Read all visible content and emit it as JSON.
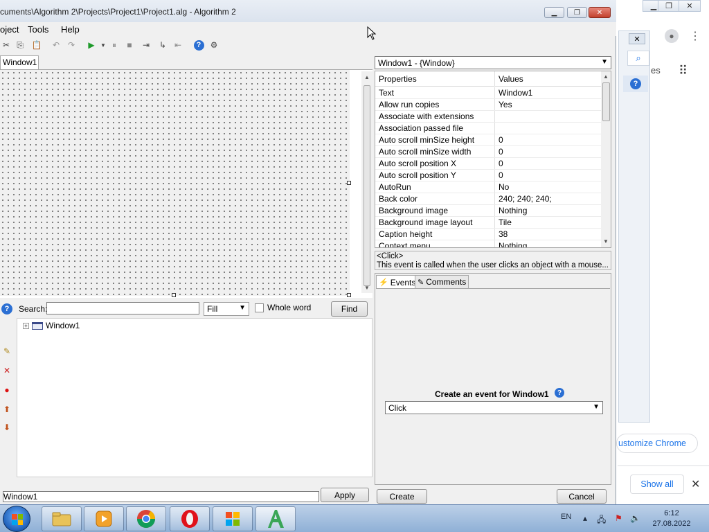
{
  "window": {
    "title": "cuments\\Algorithm 2\\Projects\\Project1\\Project1.alg - Algorithm 2",
    "minimize_glyph": "▁",
    "maximize_glyph": "❐",
    "close_glyph": "✕"
  },
  "menu": [
    "oject",
    "Tools",
    "Help"
  ],
  "toolbar_icons": [
    "cut-icon",
    "copy-icon",
    "paste-icon",
    "undo-icon",
    "redo-icon",
    "run-icon",
    "run-dropdown-icon",
    "pause-icon",
    "stop-icon",
    "step-into-icon",
    "step-over-icon",
    "step-out-icon",
    "help-icon",
    "settings-icon"
  ],
  "designer": {
    "tab_label": "Window1"
  },
  "search": {
    "label": "Search:",
    "value": "",
    "mode": "Fill",
    "whole_word_label": "Whole word",
    "whole_word_checked": false,
    "find_label": "Find"
  },
  "tree": {
    "nodes": [
      "Window1"
    ]
  },
  "name_editor": {
    "value": "Window1",
    "apply_label": "Apply"
  },
  "properties": {
    "object": "Window1 - {Window}",
    "col_properties": "Properties",
    "col_values": "Values",
    "rows": [
      {
        "name": "Text",
        "value": "Window1"
      },
      {
        "name": "Allow run copies",
        "value": "Yes"
      },
      {
        "name": "Associate with extensions",
        "value": ""
      },
      {
        "name": "Association passed file",
        "value": ""
      },
      {
        "name": "Auto scroll minSize height",
        "value": "0"
      },
      {
        "name": "Auto scroll minSize width",
        "value": "0"
      },
      {
        "name": "Auto scroll position X",
        "value": "0"
      },
      {
        "name": "Auto scroll position Y",
        "value": "0"
      },
      {
        "name": "AutoRun",
        "value": "No"
      },
      {
        "name": "Back color",
        "value": "240; 240; 240;"
      },
      {
        "name": "Background image",
        "value": "Nothing"
      },
      {
        "name": "Background image layout",
        "value": "Tile"
      },
      {
        "name": "Caption height",
        "value": "38"
      },
      {
        "name": "Context menu",
        "value": "Nothing"
      }
    ]
  },
  "description": {
    "line1": "<Click>",
    "line2": "This event is called when the user clicks an object with a mouse..."
  },
  "events": {
    "tab_events": "Events",
    "tab_comments": "Comments",
    "create_label": "Create an event for Window1",
    "selected_event": "Click",
    "create_button": "Create",
    "cancel_button": "Cancel"
  },
  "chrome": {
    "customize_label": "ustomize Chrome",
    "show_all_label": "Show all",
    "fragment_text": "es"
  },
  "taskbar": {
    "language": "EN",
    "time": "6:12",
    "date": "27.08.2022",
    "apps": [
      "explorer-icon",
      "media-player-icon",
      "chrome-icon",
      "opera-icon",
      "store-icon",
      "algorithm-icon"
    ]
  },
  "colors": {
    "accent": "#2b6fd3",
    "chrome_link": "#1a73e8",
    "close_button": "#c2402d",
    "taskbar": "#a5c0df"
  }
}
